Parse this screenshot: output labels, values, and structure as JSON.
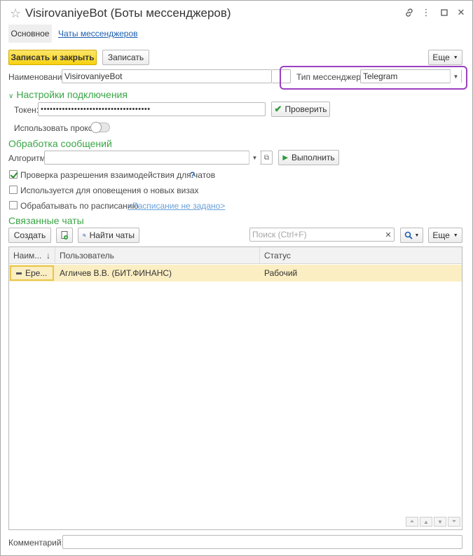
{
  "window": {
    "title": "VisirovaniyeBot (Боты мессенджеров)"
  },
  "tabs": {
    "main": "Основное",
    "chats_link": "Чаты мессенджеров"
  },
  "toolbar": {
    "save_close": "Записать и закрыть",
    "save": "Записать",
    "more": "Еще"
  },
  "form": {
    "name_label": "Наименование:",
    "name_value": "VisirovaniyeBot",
    "messenger_type_label": "Тип мессенджера:",
    "messenger_type_value": "Telegram"
  },
  "connection": {
    "section_title": "Настройки подключения",
    "token_label": "Токен:",
    "token_value": "••••••••••••••••••••••••••••••••••••",
    "check_button": "Проверить",
    "proxy_label": "Использовать прокси:"
  },
  "processing": {
    "section_title": "Обработка сообщений",
    "algorithm_label": "Алгоритм:",
    "algorithm_value": "",
    "run_button": "Выполнить",
    "check_permission_label": "Проверка разрешения взаимодействия для чатов",
    "check_permission_checked": true,
    "help_mark": "?",
    "notify_label": "Используется для оповещения о новых визах",
    "notify_checked": false,
    "schedule_label": "Обрабатывать по расписанию",
    "schedule_checked": false,
    "schedule_link": "<Расписание не задано>"
  },
  "linked_chats": {
    "section_title": "Связанные чаты",
    "create_button": "Создать",
    "find_button": "Найти чаты",
    "search_placeholder": "Поиск (Ctrl+F)",
    "more": "Еще",
    "columns": [
      "Наим...",
      "Пользователь",
      "Статус"
    ],
    "sort_mark": "↓",
    "rows": [
      {
        "name": "Ере...",
        "user": "Агличев В.В. (БИТ.ФИНАНС)",
        "status": "Рабочий"
      }
    ]
  },
  "footer": {
    "comment_label": "Комментарий:",
    "comment_value": ""
  },
  "colors": {
    "accent_green": "#3aa546",
    "primary_yellow": "#f6d10f",
    "highlight_purple": "#9b3fbf",
    "link_blue": "#1c5fb0"
  }
}
